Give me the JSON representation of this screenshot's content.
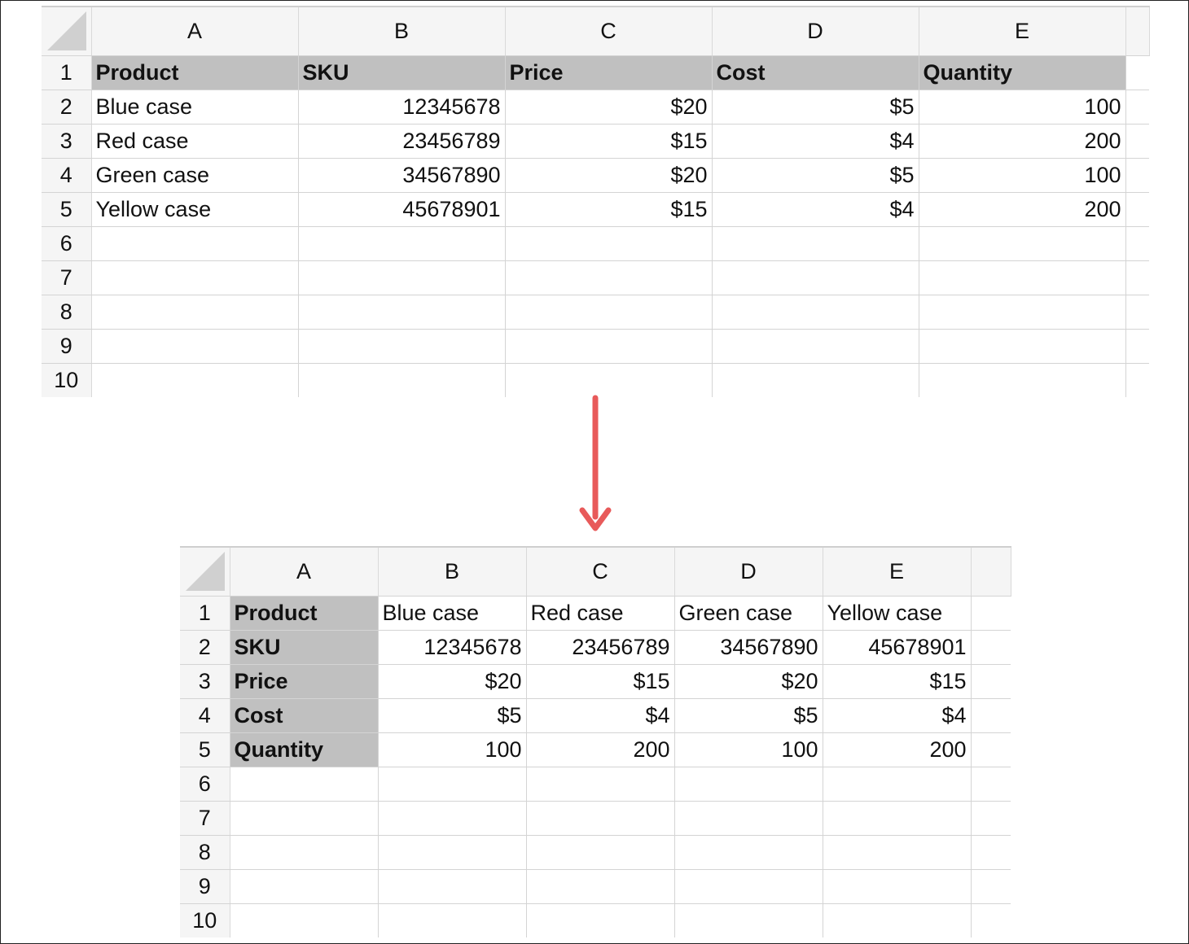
{
  "top_sheet": {
    "columns": [
      "A",
      "B",
      "C",
      "D",
      "E"
    ],
    "row_numbers": [
      "1",
      "2",
      "3",
      "4",
      "5",
      "6",
      "7",
      "8",
      "9",
      "10"
    ],
    "header": [
      "Product",
      "SKU",
      "Price",
      "Cost",
      "Quantity"
    ],
    "rows": [
      [
        "Blue case",
        "12345678",
        "$20",
        "$5",
        "100"
      ],
      [
        "Red case",
        "23456789",
        "$15",
        "$4",
        "200"
      ],
      [
        "Green case",
        "34567890",
        "$20",
        "$5",
        "100"
      ],
      [
        "Yellow case",
        "45678901",
        "$15",
        "$4",
        "200"
      ]
    ]
  },
  "bottom_sheet": {
    "columns": [
      "A",
      "B",
      "C",
      "D",
      "E"
    ],
    "row_numbers": [
      "1",
      "2",
      "3",
      "4",
      "5",
      "6",
      "7",
      "8",
      "9",
      "10"
    ],
    "rows": [
      [
        "Product",
        "Blue case",
        "Red case",
        "Green case",
        "Yellow case"
      ],
      [
        "SKU",
        "12345678",
        "23456789",
        "34567890",
        "45678901"
      ],
      [
        "Price",
        "$20",
        "$15",
        "$20",
        "$15"
      ],
      [
        "Cost",
        "$5",
        "$4",
        "$5",
        "$4"
      ],
      [
        "Quantity",
        "100",
        "200",
        "100",
        "200"
      ]
    ]
  },
  "colors": {
    "header_shade": "#c0c0c0",
    "gridline": "#d4d4d4",
    "arrow": "#e85a5a"
  },
  "icons": {
    "transpose_arrow": "down-arrow-icon",
    "select_all": "select-all-triangle-icon"
  }
}
